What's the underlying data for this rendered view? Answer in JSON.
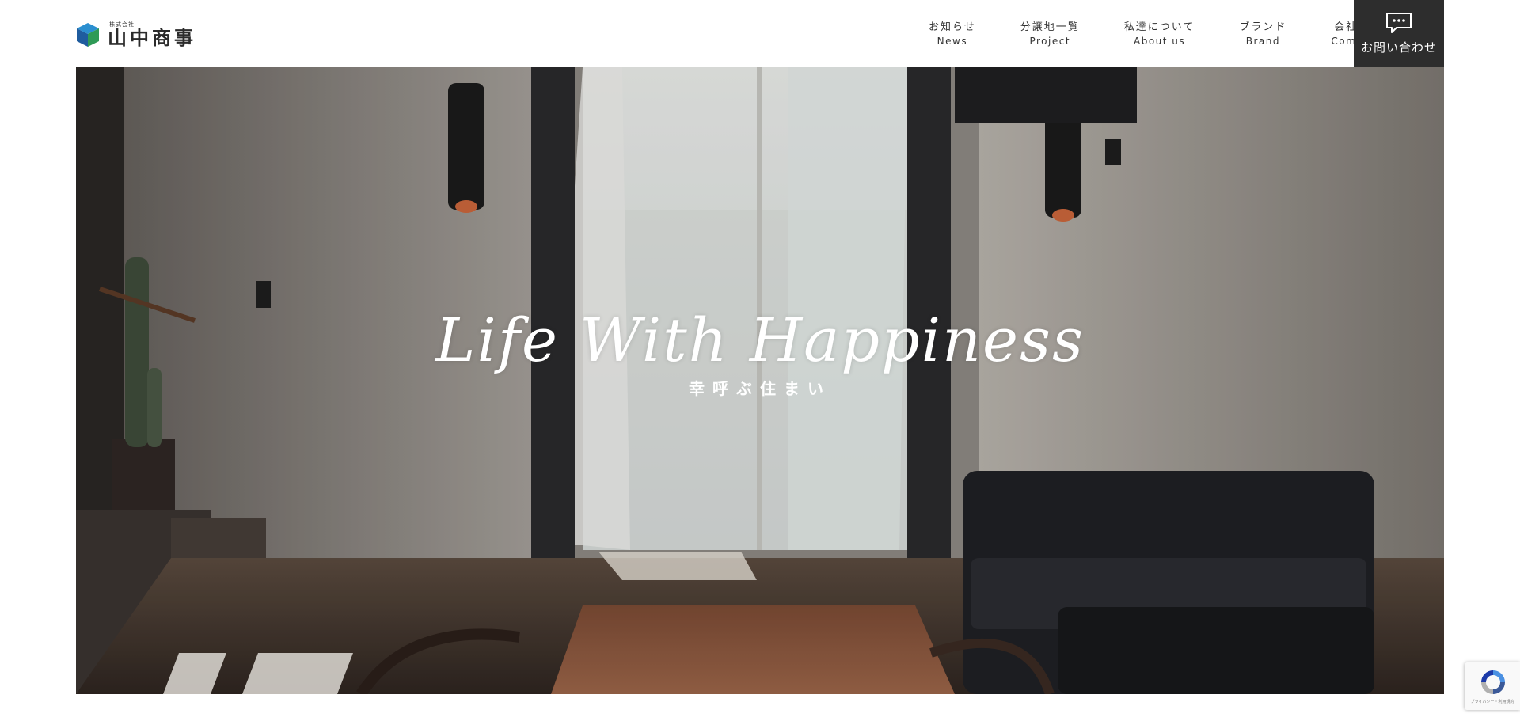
{
  "header": {
    "logo": {
      "small": "株式会社",
      "main": "山中商事"
    },
    "nav": [
      {
        "jp": "お知らせ",
        "en": "News"
      },
      {
        "jp": "分譲地一覧",
        "en": "Project"
      },
      {
        "jp": "私達について",
        "en": "About us"
      },
      {
        "jp": "ブランド",
        "en": "Brand"
      },
      {
        "jp": "会社概要",
        "en": "Company"
      }
    ],
    "contact": {
      "label": "お問い合わせ",
      "icon": "chat-bubble-icon"
    }
  },
  "hero": {
    "title": "Life With Happiness",
    "subtitle": "幸呼ぶ住まい"
  },
  "recaptcha": {
    "text": "プライバシー・利用規約"
  },
  "colors": {
    "contact_bg": "#2d2d2d",
    "logo_blue": "#1f6fb2",
    "logo_green": "#2f9a56"
  }
}
